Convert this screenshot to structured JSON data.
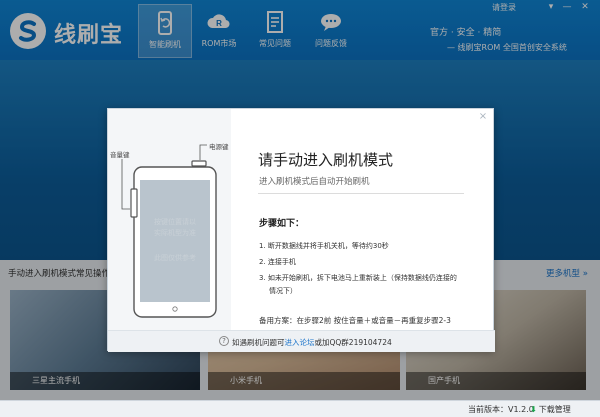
{
  "app": {
    "name": "线刷宝"
  },
  "header": {
    "nav": [
      {
        "label": "智能刷机",
        "icon": "phone-refresh-icon",
        "active": true
      },
      {
        "label": "ROM市场",
        "icon": "rom-cloud-icon",
        "active": false
      },
      {
        "label": "常见问题",
        "icon": "document-icon",
        "active": false
      },
      {
        "label": "问题反馈",
        "icon": "chat-bubble-icon",
        "active": false
      }
    ],
    "login_label": "请登录",
    "links": [
      "官方",
      "安全",
      "精简"
    ],
    "link_separator": "·",
    "slogan": "— 线刷宝ROM  全国首创安全系统"
  },
  "section": {
    "title": "手动进入刷机模式常见操作",
    "more_link": "更多机型 »"
  },
  "cards": [
    {
      "caption": "三星主流手机"
    },
    {
      "caption": "小米手机"
    },
    {
      "caption": "国产手机"
    }
  ],
  "status": {
    "version_label": "当前版本：V1.2.0",
    "download_label": "下载管理"
  },
  "dialog": {
    "close_glyph": "×",
    "volume_key_label": "音量键",
    "power_key_label": "电源键",
    "phone_screen_text": "按键位置请以\n实际机型为准",
    "phone_screen_text2": "此图仅供参考",
    "title": "请手动进入刷机模式",
    "subtitle": "进入刷机模式后自动开始刷机",
    "steps_title": "步骤如下：",
    "steps": [
      "1. 断开数据线并将手机关机，等待约30秒",
      "2. 连接手机",
      "3. 如未开始刷机，拆下电池马上重新装上（保持数据线仍连接的",
      "情况下）"
    ],
    "backup_plan": "备用方案：在步骤2前 按住音量＋或音量－再重复步骤2-3",
    "footer_prefix": "如遇刷机问题可",
    "footer_link": "进入论坛",
    "footer_suffix": "或加QQ群219104724",
    "help_glyph": "?"
  },
  "colors": {
    "header_blue": "#0c73c4",
    "link_blue": "#1a73c9",
    "download_green": "#1aa24a"
  }
}
